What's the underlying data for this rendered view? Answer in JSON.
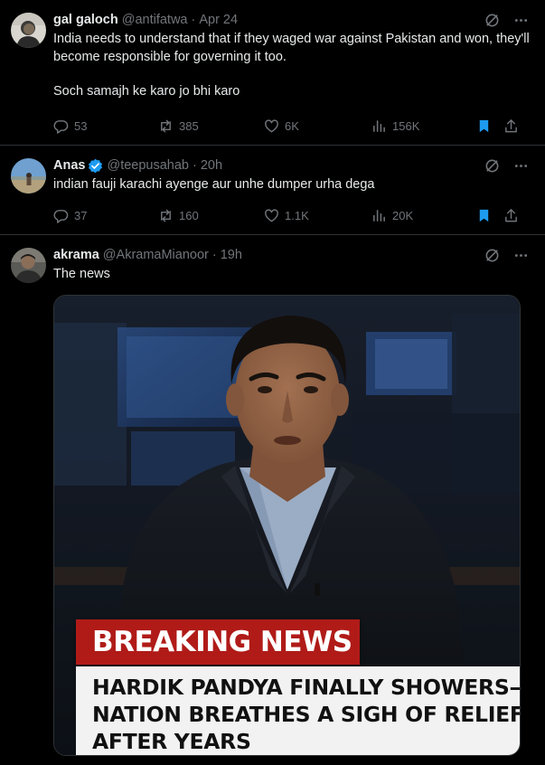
{
  "tweets": [
    {
      "name": "gal galoch",
      "handle": "@antifatwa",
      "time": "Apr 24",
      "verified": false,
      "paragraphs": [
        "India needs to understand that if they waged war against Pakistan and won, they'll become responsible for governing it too.",
        "Soch samajh ke karo jo bhi karo"
      ],
      "stats": {
        "replies": "53",
        "reposts": "385",
        "likes": "6K",
        "views": "156K"
      }
    },
    {
      "name": "Anas",
      "handle": "@teepusahab",
      "time": "20h",
      "verified": true,
      "paragraphs": [
        "indian fauji karachi ayenge aur unhe dumper urha dega"
      ],
      "stats": {
        "replies": "37",
        "reposts": "160",
        "likes": "1.1K",
        "views": "20K"
      }
    },
    {
      "name": "akrama",
      "handle": "@AkramaMianoor",
      "time": "19h",
      "verified": false,
      "paragraphs": [
        "The news"
      ],
      "media": {
        "banner_red": "BREAKING NEWS",
        "banner_lines": [
          "HARDIK PANDYA FINALLY SHOWERS—",
          "NATION BREATHES A SIGH OF RELIEF",
          "AFTER YEARS"
        ]
      }
    }
  ],
  "colors": {
    "background": "#000000",
    "text": "#e7e9ea",
    "muted": "#71767b",
    "bookmark_active": "#1d9bf0",
    "verified": "#1d9bf0",
    "breaking_red": "#b01b18"
  },
  "icons": [
    "grok-icon",
    "more-icon",
    "reply-icon",
    "repost-icon",
    "like-icon",
    "views-icon",
    "bookmark-icon",
    "share-icon"
  ]
}
